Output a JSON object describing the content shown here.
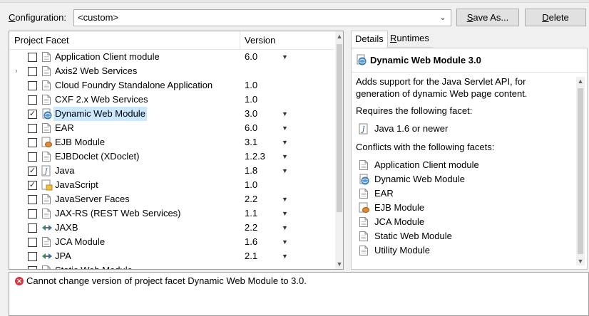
{
  "configuration": {
    "label_prefix": "",
    "label_underlined": "C",
    "label_rest": "onfiguration:",
    "value": "<custom>",
    "save_prefix": "",
    "save_underlined": "S",
    "save_rest": "ave As...",
    "delete_prefix": "",
    "delete_underlined": "D",
    "delete_rest": "elete"
  },
  "table": {
    "col_facet": "Project Facet",
    "col_version": "Version",
    "rows": [
      {
        "name": "Application Client module",
        "version": "6.0",
        "checked": false,
        "dropdown": true,
        "expander": false,
        "icon": "page-icon"
      },
      {
        "name": "Axis2 Web Services",
        "version": "",
        "checked": false,
        "dropdown": false,
        "expander": true,
        "icon": "page-icon"
      },
      {
        "name": "Cloud Foundry Standalone Application",
        "version": "1.0",
        "checked": false,
        "dropdown": false,
        "expander": false,
        "icon": "page-icon"
      },
      {
        "name": "CXF 2.x Web Services",
        "version": "1.0",
        "checked": false,
        "dropdown": false,
        "expander": false,
        "icon": "page-icon"
      },
      {
        "name": "Dynamic Web Module",
        "version": "3.0",
        "checked": true,
        "dropdown": true,
        "expander": false,
        "icon": "globe-icon",
        "selected": true
      },
      {
        "name": "EAR",
        "version": "6.0",
        "checked": false,
        "dropdown": true,
        "expander": false,
        "icon": "page-icon"
      },
      {
        "name": "EJB Module",
        "version": "3.1",
        "checked": false,
        "dropdown": true,
        "expander": false,
        "icon": "bean-icon"
      },
      {
        "name": "EJBDoclet (XDoclet)",
        "version": "1.2.3",
        "checked": false,
        "dropdown": true,
        "expander": false,
        "icon": "page-icon"
      },
      {
        "name": "Java",
        "version": "1.8",
        "checked": true,
        "dropdown": true,
        "expander": false,
        "icon": "java-icon"
      },
      {
        "name": "JavaScript",
        "version": "1.0",
        "checked": true,
        "dropdown": false,
        "expander": false,
        "icon": "js-icon"
      },
      {
        "name": "JavaServer Faces",
        "version": "2.2",
        "checked": false,
        "dropdown": true,
        "expander": false,
        "icon": "page-icon"
      },
      {
        "name": "JAX-RS (REST Web Services)",
        "version": "1.1",
        "checked": false,
        "dropdown": true,
        "expander": false,
        "icon": "page-icon"
      },
      {
        "name": "JAXB",
        "version": "2.2",
        "checked": false,
        "dropdown": true,
        "expander": false,
        "icon": "arrows-icon"
      },
      {
        "name": "JCA Module",
        "version": "1.6",
        "checked": false,
        "dropdown": true,
        "expander": false,
        "icon": "page-icon"
      },
      {
        "name": "JPA",
        "version": "2.1",
        "checked": false,
        "dropdown": true,
        "expander": false,
        "icon": "arrows-icon"
      },
      {
        "name": "Static Web Module",
        "version": "",
        "checked": false,
        "dropdown": false,
        "expander": false,
        "icon": "page-icon"
      }
    ]
  },
  "details": {
    "tab_details": "Details",
    "tab_runtimes_underlined": "R",
    "tab_runtimes_rest": "untimes",
    "title": "Dynamic Web Module 3.0",
    "description": "Adds support for the Java Servlet API, for generation of dynamic Web page content.",
    "requires_heading": "Requires the following facet:",
    "requires": [
      {
        "name": "Java 1.6 or newer",
        "icon": "java-icon"
      }
    ],
    "conflicts_heading": "Conflicts with the following facets:",
    "conflicts": [
      {
        "name": "Application Client module",
        "icon": "page-icon"
      },
      {
        "name": "Dynamic Web Module",
        "icon": "globe-icon"
      },
      {
        "name": "EAR",
        "icon": "page-icon"
      },
      {
        "name": "EJB Module",
        "icon": "bean-icon"
      },
      {
        "name": "JCA Module",
        "icon": "page-icon"
      },
      {
        "name": "Static Web Module",
        "icon": "page-icon"
      },
      {
        "name": "Utility Module",
        "icon": "page-icon"
      }
    ]
  },
  "problem": {
    "message": "Cannot change version of project facet Dynamic Web Module to 3.0."
  },
  "colors": {
    "selection": "#cce8ff",
    "error": "#d9363e",
    "window_bg": "#f0f0f0"
  }
}
